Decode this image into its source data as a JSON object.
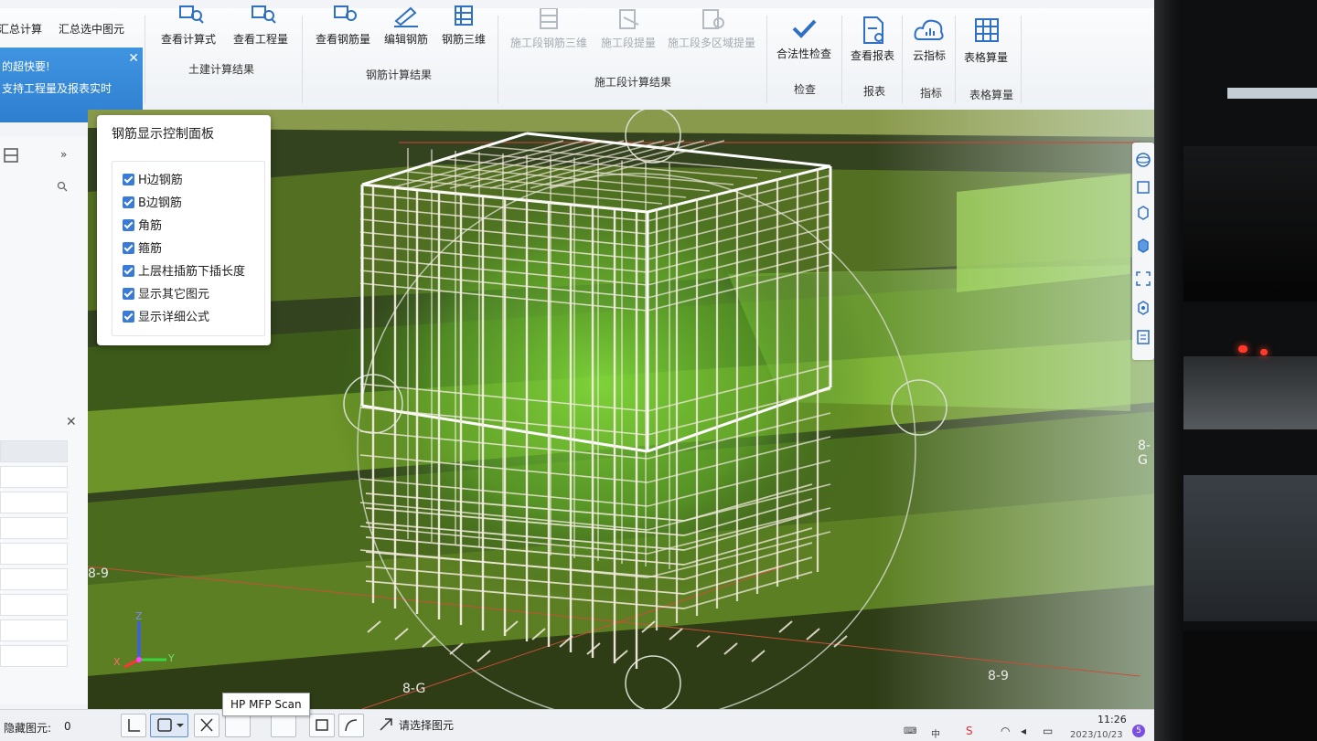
{
  "ribbon": {
    "summary": {
      "calc": "汇总计算",
      "calc_selected": "汇总选中图元"
    },
    "civil": {
      "view_formula": "查看计算式",
      "view_quantity": "查看工程量",
      "group": "土建计算结果"
    },
    "rebar": {
      "view_rebar": "查看钢筋量",
      "edit_rebar": "编辑钢筋",
      "rebar_3d": "钢筋三维",
      "group": "钢筋计算结果"
    },
    "stage": {
      "stage_3d": "施工段钢筋三维",
      "stage_quantity": "施工段提量",
      "stage_multi": "施工段多区域提量",
      "group": "施工段计算结果"
    },
    "check": {
      "legality": "合法性检查",
      "group": "检查"
    },
    "report": {
      "view_report": "查看报表",
      "group": "报表"
    },
    "index": {
      "cloud_index": "云指标",
      "group": "指标"
    },
    "table": {
      "table_calc": "表格算量",
      "group": "表格算量"
    }
  },
  "notification": {
    "line1": "的超快要!",
    "line2": "支持工程量及报表实时"
  },
  "control_panel": {
    "title": "钢筋显示控制面板",
    "options": [
      {
        "label": "H边钢筋",
        "checked": true
      },
      {
        "label": "B边钢筋",
        "checked": true
      },
      {
        "label": "角筋",
        "checked": true
      },
      {
        "label": "箍筋",
        "checked": true
      },
      {
        "label": "上层柱插筋下插长度",
        "checked": true
      },
      {
        "label": "显示其它图元",
        "checked": true
      },
      {
        "label": "显示详细公式",
        "checked": true
      }
    ]
  },
  "viewport": {
    "axis_left": "8-9",
    "axis_bottom": "8-G",
    "axis_right_bottom": "8-9",
    "axis_right": "8-G",
    "z": "Z",
    "x": "X",
    "y": "Y"
  },
  "status": {
    "hidden_label": "隐藏图元:",
    "hidden_count": "0",
    "hint": "请选择图元",
    "tooltip": "HP MFP Scan",
    "time": "11:26",
    "date": "2023/10/23"
  },
  "colors": {
    "accent": "#3a7bd5",
    "rebar": "#f4ecdf",
    "slab": "#6f9a2f"
  }
}
